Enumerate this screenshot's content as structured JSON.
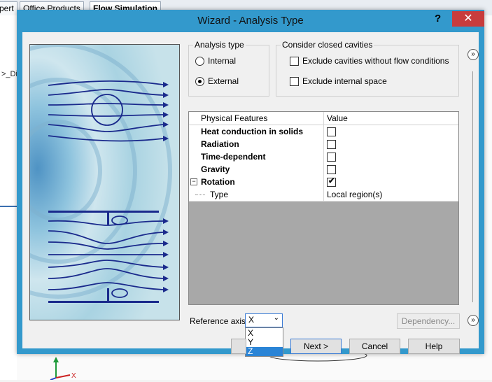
{
  "background": {
    "tabs": [
      "pert",
      "Office Products",
      "Flow Simulation"
    ],
    "left_panel_text": ">_Di"
  },
  "dialog": {
    "title": "Wizard - Analysis Type",
    "help_label": "?",
    "close_label": "✕"
  },
  "analysis_type": {
    "legend": "Analysis type",
    "options": [
      {
        "label": "Internal",
        "selected": false
      },
      {
        "label": "External",
        "selected": true
      }
    ]
  },
  "cavities": {
    "legend": "Consider closed cavities",
    "options": [
      {
        "label": "Exclude cavities without flow conditions",
        "checked": false
      },
      {
        "label": "Exclude internal space",
        "checked": false
      }
    ]
  },
  "features_table": {
    "headers": [
      "Physical Features",
      "Value"
    ],
    "rows": [
      {
        "name": "Heat conduction in solids",
        "checked": false
      },
      {
        "name": "Radiation",
        "checked": false
      },
      {
        "name": "Time-dependent",
        "checked": false
      },
      {
        "name": "Gravity",
        "checked": false
      },
      {
        "name": "Rotation",
        "checked": true,
        "expander": "−"
      }
    ],
    "sub_row": {
      "name": "Type",
      "value": "Local region(s)"
    }
  },
  "reference_axis": {
    "label": "Reference axis:",
    "value": "X",
    "options": [
      "X",
      "Y",
      "Z"
    ],
    "highlighted": "Z"
  },
  "buttons": {
    "dependency": "Dependency...",
    "next": "Next >",
    "cancel": "Cancel",
    "help": "Help"
  },
  "colors": {
    "dialog_frame": "#3399cc",
    "close_button": "#c83c3c",
    "dropdown_highlight": "#2a84d6",
    "flow_lines": "#1a2a8c"
  }
}
